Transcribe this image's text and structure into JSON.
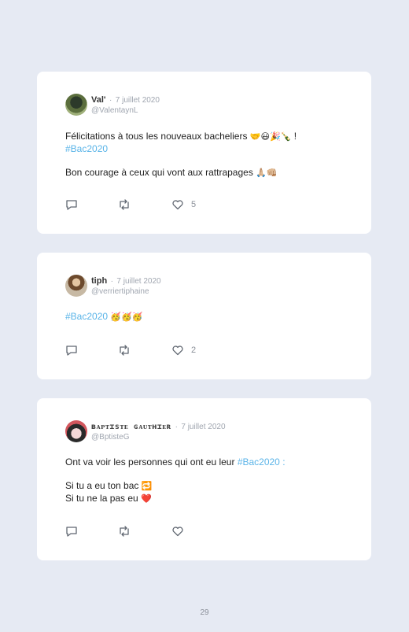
{
  "tweets": [
    {
      "name": "Val'",
      "sep": "·",
      "date": "7 juillet 2020",
      "handle": "@ValentaynL",
      "line1": "Félicitations à tous les nouveaux bacheliers",
      "line1_emoji": "🤝😃🎉🍾",
      "line1_end": "!",
      "hashtag": "#Bac2020",
      "line3": "Bon courage à ceux qui vont aux rattrapages",
      "line3_emoji": "🙏🏼👊🏼",
      "likes": "5"
    },
    {
      "name": "tiph",
      "sep": "·",
      "date": "7 juillet 2020",
      "handle": "@verriertiphaine",
      "hashtag": "#Bac2020",
      "emoji": "🥳🥳🥳",
      "likes": "2"
    },
    {
      "name": "ʙᴀᴘᴛɪsᴛᴇ ɢᴀᴜᴛʜɪᴇʀ",
      "sep": "·",
      "date": "7 juillet 2020",
      "handle": "@BptisteG",
      "line1": "Ont va voir les personnes qui ont eu leur",
      "hashtag": "#Bac2020",
      "line1_end": ":",
      "line2": "Si tu a eu ton bac",
      "line2_emoji": "🔁",
      "line3": "Si tu ne la pas eu",
      "line3_emoji": "❤️"
    }
  ],
  "page_number": "29",
  "icons": [
    "reply-icon",
    "retweet-icon",
    "like-icon"
  ],
  "colors": {
    "background": "#e6eaf3",
    "card": "#ffffff",
    "hashtag": "#5ab4e8",
    "muted": "#a0a6b0"
  }
}
